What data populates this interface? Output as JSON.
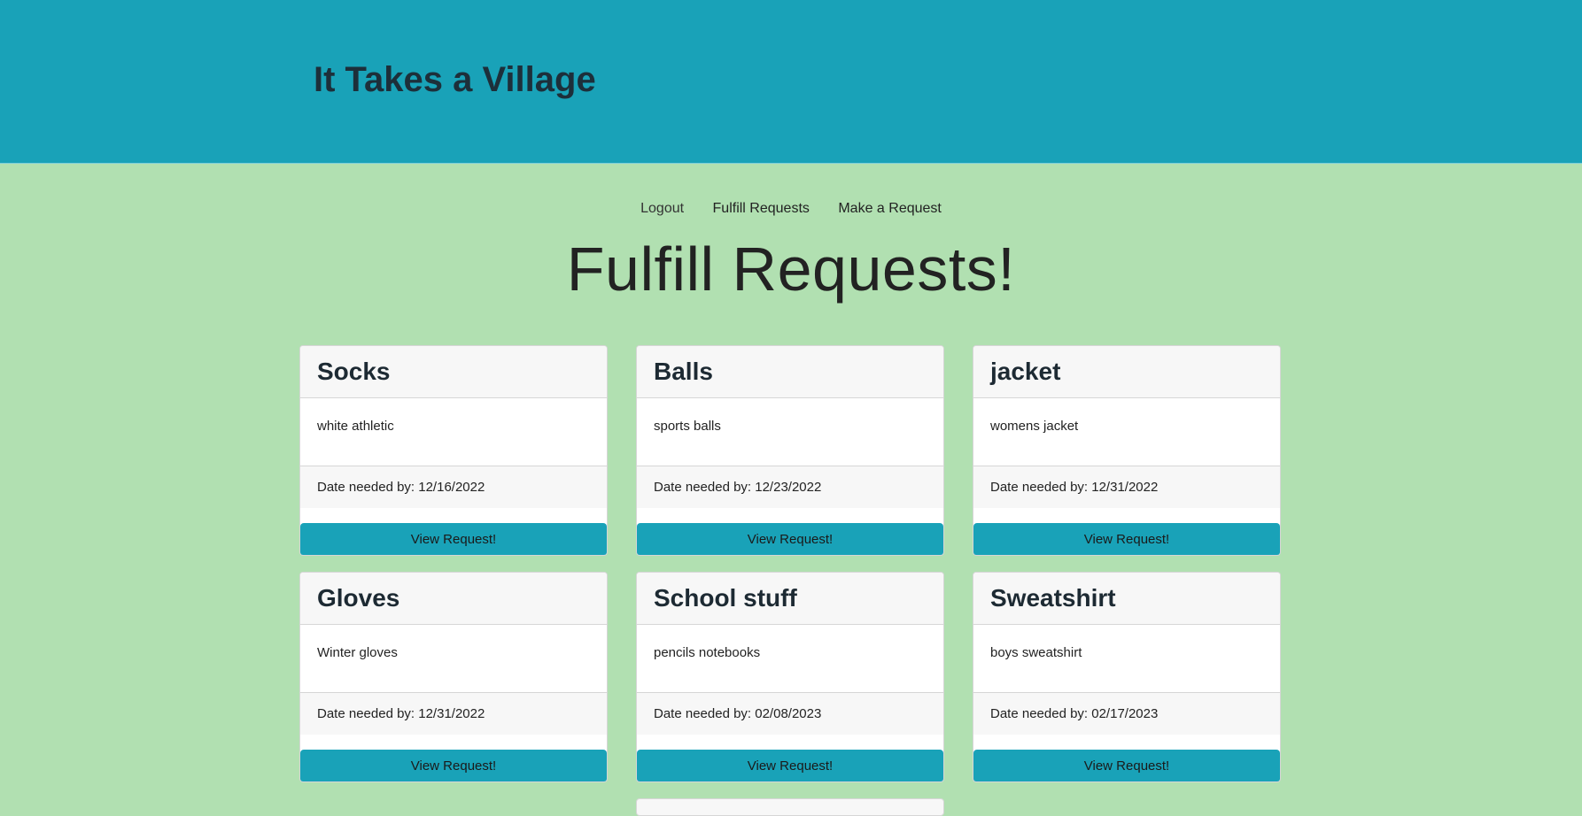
{
  "header": {
    "title": "It Takes a Village"
  },
  "nav": {
    "logout": "Logout",
    "fulfill": "Fulfill Requests",
    "make": "Make a Request"
  },
  "page": {
    "heading": "Fulfill Requests!"
  },
  "cards": [
    {
      "title": "Socks",
      "description": "white athletic",
      "date": "Date needed by: 12/16/2022",
      "button": "View Request!"
    },
    {
      "title": "Balls",
      "description": "sports balls",
      "date": "Date needed by: 12/23/2022",
      "button": "View Request!"
    },
    {
      "title": "jacket",
      "description": "womens jacket",
      "date": "Date needed by: 12/31/2022",
      "button": "View Request!"
    },
    {
      "title": "Gloves",
      "description": "Winter gloves",
      "date": "Date needed by: 12/31/2022",
      "button": "View Request!"
    },
    {
      "title": "School stuff",
      "description": "pencils notebooks",
      "date": "Date needed by: 02/08/2023",
      "button": "View Request!"
    },
    {
      "title": "Sweatshirt",
      "description": "boys sweatshirt",
      "date": "Date needed by: 02/17/2023",
      "button": "View Request!"
    }
  ],
  "colors": {
    "header_bg": "#19a2b8",
    "page_bg": "#b1e0b1",
    "button_bg": "#19a2b8"
  }
}
